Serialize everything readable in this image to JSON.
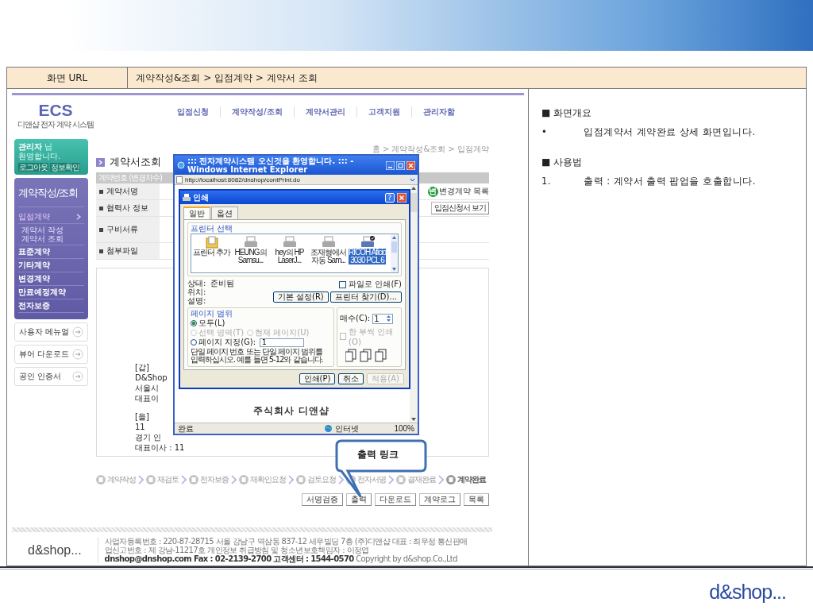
{
  "screen_url": {
    "label": "화면 URL",
    "path": "계약작성&조회 > 입점계약 > 계약서 조회"
  },
  "app": {
    "logo": "ECS",
    "logo_subtitle": "디앤샵 전자 계약 시스템",
    "top_nav": [
      "입점신청",
      "계약작성/조회",
      "계약서관리",
      "고객지원",
      "관리자함"
    ],
    "welcome": "**관리자** 님",
    "greeting": "환영합니다.",
    "user_buttons": [
      "로그아웃",
      "정보확인"
    ],
    "menu_title": "계약작성/조회",
    "menu_items": [
      {
        "label": "입점계약",
        "selected": true,
        "expanded": true,
        "children": [
          {
            "label": "계약서 작성"
          },
          {
            "label": "계약서 조회"
          }
        ]
      },
      {
        "label": "표준계약",
        "selected": false,
        "expanded": false
      },
      {
        "label": "기타계약",
        "selected": false,
        "expanded": false
      },
      {
        "label": "변경계약",
        "selected": false,
        "expanded": false
      },
      {
        "label": "만료예정계약",
        "selected": false,
        "expanded": false
      },
      {
        "label": "전자보증",
        "selected": false,
        "expanded": false
      }
    ],
    "side_links": [
      "사용자 메뉴얼",
      "뷰어 다운로드",
      "공인 인증서"
    ],
    "breadcrumb": "홈 > 계약작성&조회 > 입점계약",
    "page_title": "계약서조회",
    "info_table": {
      "header": "계약번호 (변경차수)",
      "rows": [
        {
          "label": "계약서명",
          "link_badge": "변",
          "link": "변경계약 목록"
        },
        {
          "label": "협력사 정보",
          "button": "입점신청서 보기"
        },
        {
          "label": "구비서류"
        },
        {
          "label": "첨부파일"
        }
      ]
    },
    "document_groups": [
      {
        "lines": [
          "[갑]",
          "D&Shop",
          "서울시",
          "대표이"
        ]
      },
      {
        "lines": [
          "[을]",
          "11",
          "경기 인",
          "대표이사 : 11"
        ]
      }
    ],
    "steps": [
      {
        "label": "계약작성",
        "current": false
      },
      {
        "label": "재검토",
        "current": false
      },
      {
        "label": "전자보증",
        "current": false
      },
      {
        "label": "재확인요청",
        "current": false
      },
      {
        "label": "검토요청",
        "current": false
      },
      {
        "label": "전자서명",
        "current": false
      },
      {
        "label": "결재완료",
        "current": false
      },
      {
        "label": "계약완료",
        "current": true
      }
    ],
    "action_buttons": [
      "서명검증",
      "출력",
      "다운로드",
      "계약로그",
      "목록"
    ],
    "footer_logo": "d&shop...",
    "footer_lines": [
      "사업자등록번호 : 220-87-28715 서울 강남구 역삼동 837-12 세우빌딩 7층 (주)디앤샵 대표 : 최우정 통신판매업신고번호 : 제 강남-11217호 개인정보 취급방침 및 청소년보호책임자 : 이정엽",
      "**dnshop@dnshop.com Fax : 02-2139-2700 고객센터 : 1544-0570** Copyright by d&shop.Co.,Ltd"
    ]
  },
  "popup": {
    "title": "::: 전자계약시스템 오신것을 환영합니다. ::: - Windows Internet Explorer",
    "address": "http://localhost:8082/dnshop/contPrint.do",
    "document_title": "주식회사 디앤샵",
    "status": "완료",
    "zone": "인터넷",
    "zoom": "100%"
  },
  "print_dialog": {
    "title": "인쇄",
    "help_button": "?",
    "tabs": [
      {
        "label": "일반",
        "selected": true
      },
      {
        "label": "옵션",
        "selected": false
      }
    ],
    "printer_group": "프린터 선택",
    "printers": [
      {
        "label": "프린터 추가",
        "kind": "add",
        "selected": false,
        "default": false
      },
      {
        "label": "HEUNG의 Samsu...",
        "kind": "printer",
        "selected": false,
        "default": false
      },
      {
        "label": "hey의 HP LaserJ...",
        "kind": "printer",
        "selected": false,
        "default": false
      },
      {
        "label": "조재형에서 자동 Sam...",
        "kind": "printer",
        "selected": false,
        "default": false
      },
      {
        "label": "RICOH Aficio 3030 PCL 6",
        "kind": "printer",
        "selected": true,
        "default": true
      }
    ],
    "info": [
      {
        "label": "상태:",
        "value": "준비됨"
      },
      {
        "label": "위치:"
      },
      {
        "label": "설명:"
      }
    ],
    "print_to_file": {
      "label": "파일로 인쇄(F)",
      "checked": false
    },
    "side_buttons": [
      "기본 설정(R)",
      "프린터 찾기(D)..."
    ],
    "range_group": "페이지 범위",
    "range_options": [
      {
        "label": "모두(L)",
        "selected": true,
        "disabled": false
      },
      {
        "label": "선택 영역(T)",
        "selected": false,
        "disabled": true
      },
      {
        "label": "현재 페이지(U)",
        "selected": false,
        "disabled": true
      },
      {
        "label": "페이지 지정(G):",
        "selected": false,
        "disabled": false
      }
    ],
    "page_field": "1",
    "range_note": "단일 페이지 번호 또는 단일 페이지 범위를 입력하십시오. 예를 들면 5-12와 같습니다.",
    "copies_label": "매수(C):",
    "copies": "1",
    "collate": {
      "label": "한 부씩 인쇄(O)",
      "checked": false,
      "disabled": true
    },
    "buttons": [
      {
        "label": "인쇄(P)",
        "disabled": false
      },
      {
        "label": "취소",
        "disabled": false
      },
      {
        "label": "적용(A)",
        "disabled": true
      }
    ]
  },
  "callout": "출력 링크",
  "description": [
    {
      "heading": "■ 화면개요",
      "items": [
        {
          "marker": "•",
          "text": "입점계약서 계약완료 상세 화면입니다."
        }
      ]
    },
    {
      "heading": "■ 사용법",
      "items": [
        {
          "marker": "1.",
          "text": "출력 : 계약서 출력 팝업을 호출합니다."
        }
      ]
    }
  ],
  "brand_logo": "d&shop..."
}
